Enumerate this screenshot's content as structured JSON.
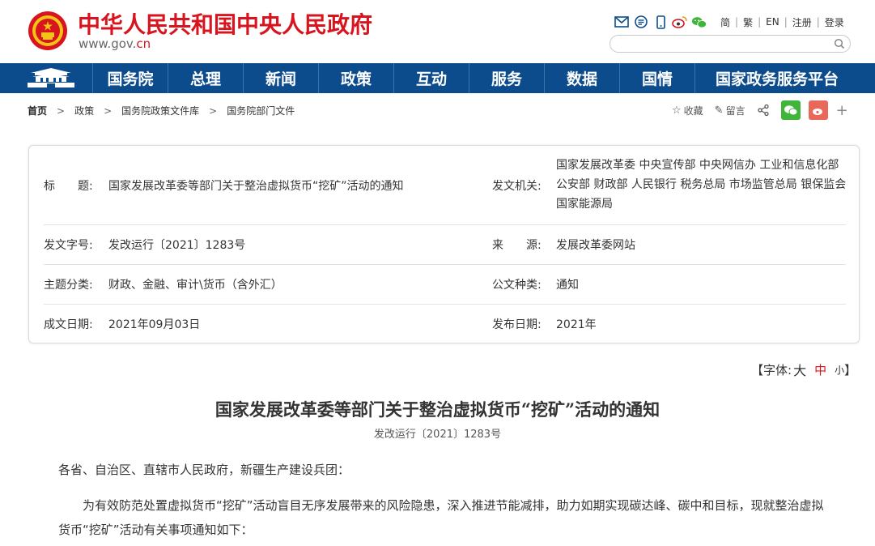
{
  "header": {
    "site_title": "中华人民共和国中央人民政府",
    "domain_prefix": "www.gov.",
    "domain_suffix": "cn",
    "lang_simplified": "简",
    "lang_traditional": "繁",
    "lang_english": "EN",
    "register": "注册",
    "login": "登录",
    "sep": "|",
    "search_placeholder": ""
  },
  "nav": {
    "items": [
      "国务院",
      "总理",
      "新闻",
      "政策",
      "互动",
      "服务",
      "数据",
      "国情",
      "国家政务服务平台"
    ]
  },
  "breadcrumb": {
    "items": [
      "首页",
      "政策",
      "国务院政策文件库",
      "国务院部门文件"
    ],
    "arrow": ">"
  },
  "share": {
    "favorite": "收藏",
    "comment": "留言"
  },
  "info": {
    "title_label": "标　　题:",
    "title_value": "国家发展改革委等部门关于整治虚拟货币“挖矿”活动的通知",
    "issuer_label": "发文机关:",
    "issuer_value": "国家发展改革委 中央宣传部 中央网信办 工业和信息化部 公安部 财政部 人民银行 税务总局 市场监管总局 银保监会 国家能源局",
    "docno_label": "发文字号:",
    "docno_value": "发改运行〔2021〕1283号",
    "source_label": "来　　源:",
    "source_value": "发展改革委网站",
    "topic_label": "主题分类:",
    "topic_value": "财政、金融、审计\\货币（含外汇）",
    "type_label": "公文种类:",
    "type_value": "通知",
    "date_label": "成文日期:",
    "date_value": "2021年09月03日",
    "pubdate_label": "发布日期:",
    "pubdate_value": "2021年"
  },
  "font_size": {
    "label": "【字体:",
    "big": "大",
    "mid": "中",
    "small": "小",
    "close": "】"
  },
  "article": {
    "title": "国家发展改革委等部门关于整治虚拟货币“挖矿”活动的通知",
    "doc_no": "发改运行〔2021〕1283号",
    "p1": "各省、自治区、直辖市人民政府，新疆生产建设兵团：",
    "p2": "为有效防范处置虚拟货币“挖矿”活动盲目无序发展带来的风险隐患，深入推进节能减排，助力如期实现碳达峰、碳中和目标，现就整治虚拟货币“挖矿”活动有关事项通知如下："
  },
  "colors": {
    "brand_red": "#d8141e",
    "nav_blue": "#0c4c8c"
  }
}
